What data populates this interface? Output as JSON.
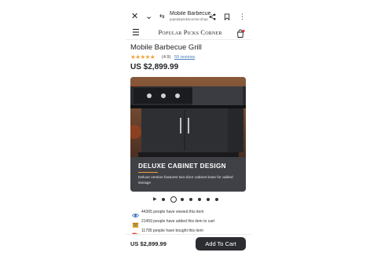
{
  "browser": {
    "page_title": "Mobile Barbecue...",
    "url": "popularpickscorner.shop",
    "icons": [
      "close-icon",
      "chevron-down-icon",
      "tune-icon",
      "share-icon",
      "bookmark-icon",
      "more-vert-icon"
    ]
  },
  "site": {
    "brand": "Popular Picks Corner",
    "menu_icon": "☰"
  },
  "product": {
    "title": "Mobile Barbecue Grill",
    "stars": "★★★★★",
    "rating": "(4.9)",
    "reviews": "59 reviews",
    "price": "US $2,899.99",
    "rating_value": 4.9
  },
  "hero": {
    "title": "DELUXE CABINET DESIGN",
    "description": "Deluxe version features two-door cabinet base for added storage",
    "accent_color": "#e9a23a"
  },
  "carousel": {
    "play_icon": "▶",
    "total_slides": 8,
    "active_index": 1
  },
  "stats": [
    {
      "icon": "eye-icon",
      "text": "44365 people have viewed this item"
    },
    {
      "icon": "box-icon",
      "text": "21459 people have added this item to cart"
    },
    {
      "icon": "truck-icon",
      "text": "11795 people have bought this item"
    }
  ],
  "bottom_bar": {
    "price": "US $2,899.99",
    "button_label": "Add To Cart"
  },
  "colors": {
    "star": "#f2a33a",
    "link": "#4a7fc1",
    "dark_button": "#2c2d31",
    "hero_bg": "#3f4147"
  }
}
